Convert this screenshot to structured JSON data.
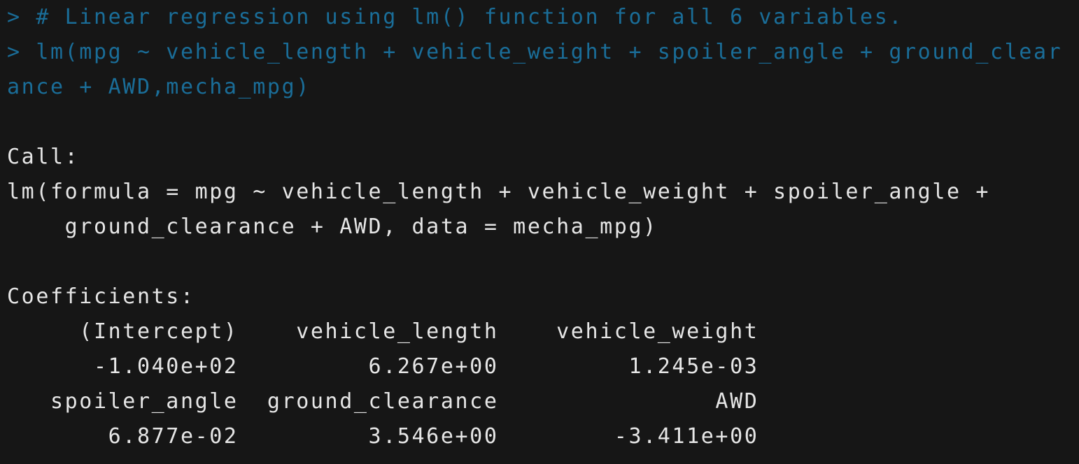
{
  "console": {
    "input_lines": [
      "> # Linear regression using lm() function for all 6 variables.",
      "> lm(mpg ~ vehicle_length + vehicle_weight + spoiler_angle + ground_clear",
      "ance + AWD,mecha_mpg)"
    ],
    "call_header": "Call:",
    "call_lines": [
      "lm(formula = mpg ~ vehicle_length + vehicle_weight + spoiler_angle + ",
      "    ground_clearance + AWD, data = mecha_mpg)"
    ],
    "coefficients_header": "Coefficients:",
    "coefficient_rows": [
      "     (Intercept)    vehicle_length    vehicle_weight",
      "      -1.040e+02         6.267e+00         1.245e-03",
      "   spoiler_angle  ground_clearance               AWD",
      "       6.877e-02         3.546e+00        -3.411e+00"
    ]
  },
  "colors": {
    "background": "#161616",
    "input_text": "#1a6d98",
    "output_text": "#e6e6e6"
  }
}
